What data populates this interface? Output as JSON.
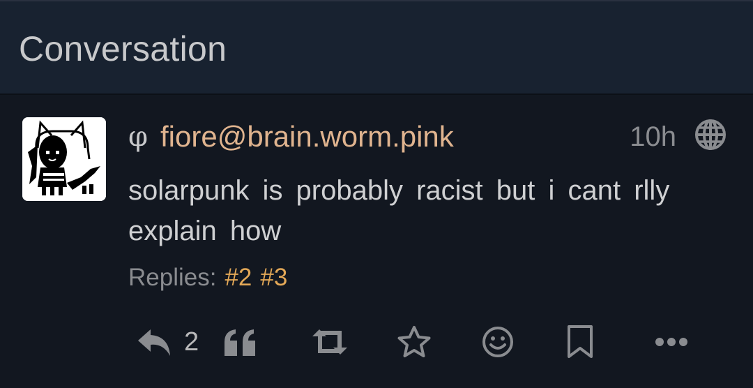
{
  "panel": {
    "title": "Conversation"
  },
  "status": {
    "avatar_icon": "pixel-cat-avatar",
    "user_marker": "φ",
    "username": "fiore@brain.worm.pink",
    "timestamp": "10h",
    "visibility_icon": "globe-icon",
    "content": "solarpunk is probably  racist but i cant rlly explain how",
    "replies_label": "Replies:",
    "replies": [
      "#2",
      "#3"
    ],
    "actions": {
      "reply_count": "2",
      "icons": [
        "reply-icon",
        "quote-icon",
        "retweet-icon",
        "star-icon",
        "emoji-icon",
        "bookmark-icon",
        "more-icon"
      ]
    }
  },
  "colors": {
    "background": "#121720",
    "heading_background": "#182230",
    "username": "#e0b48f",
    "link": "#e3a857",
    "text": "#cfd0d2",
    "muted": "#8a8c90"
  }
}
